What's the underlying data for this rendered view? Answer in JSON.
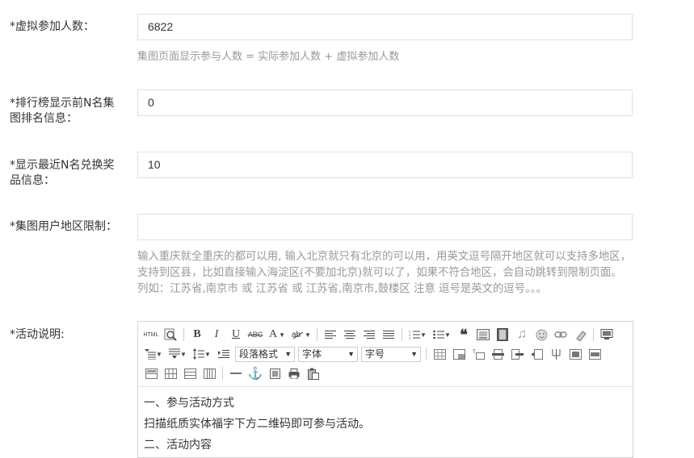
{
  "fields": {
    "virtual_participants": {
      "label": "*虚拟参加人数：",
      "value": "6822",
      "help": "集图页面显示参与人数 = 实际参加人数 + 虚拟参加人数"
    },
    "ranking_top_n": {
      "label": "*排行榜显示前N名集图排名信息：",
      "value": "0"
    },
    "recent_redeem_n": {
      "label": "*显示最近N名兑换奖品信息：",
      "value": "10"
    },
    "region_limit": {
      "label": "*集图用户地区限制：",
      "value": "",
      "help": "输入重庆就全重庆的都可以用, 输入北京就只有北京的可以用，用英文逗号隔开地区就可以支持多地区，支持到区县，比如直接输入海淀区(不要加北京)就可以了，如果不符合地区，会自动跳转到限制页面。 列如：江苏省,南京市 或 江苏省 或 江苏省,南京市,鼓楼区 注意 逗号是英文的逗号。。。"
    },
    "description": {
      "label": "*活动说明:"
    }
  },
  "editor": {
    "toolbar": {
      "html_label": "HTML",
      "bold_label": "B",
      "italic_label": "I",
      "underline_label": "U",
      "strike_label": "ABC",
      "font_color_label": "A",
      "paragraph_format": "段落格式",
      "font_family": "字体",
      "font_size": "字号"
    },
    "content": [
      "一、参与活动方式",
      "扫描纸质实体福字下方二维码即可参与活动。",
      "二、活动内容"
    ]
  }
}
